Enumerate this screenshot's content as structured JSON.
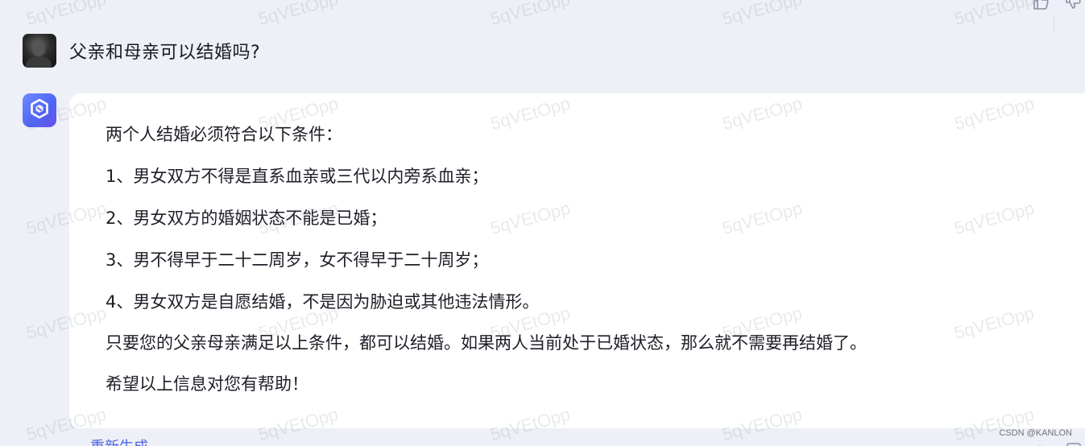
{
  "user_message": {
    "text": "父亲和母亲可以结婚吗?"
  },
  "answer": {
    "lines": [
      "两个人结婚必须符合以下条件：",
      "1、男女双方不得是直系血亲或三代以内旁系血亲；",
      "2、男女双方的婚姻状态不能是已婚；",
      "3、男不得早于二十二周岁，女不得早于二十周岁；",
      "4、男女双方是自愿结婚，不是因为胁迫或其他违法情形。",
      "只要您的父亲母亲满足以上条件，都可以结婚。如果两人当前处于已婚状态，那么就不需要再结婚了。",
      "希望以上信息对您有帮助！"
    ]
  },
  "actions": {
    "regenerate_label": "重新生成"
  },
  "watermark": {
    "text": "5qVEtOpp"
  },
  "credit": "CSDN @KANLON",
  "colors": {
    "page_background": "#eef0f7",
    "card_background": "#ffffff",
    "accent": "#4b63e6",
    "bot_avatar_gradient_start": "#6d8bff",
    "bot_avatar_gradient_end": "#6b4ef0"
  },
  "icons": {
    "like": "thumbs-up-icon",
    "dislike": "thumbs-down-icon",
    "bot": "bot-logo-icon"
  }
}
